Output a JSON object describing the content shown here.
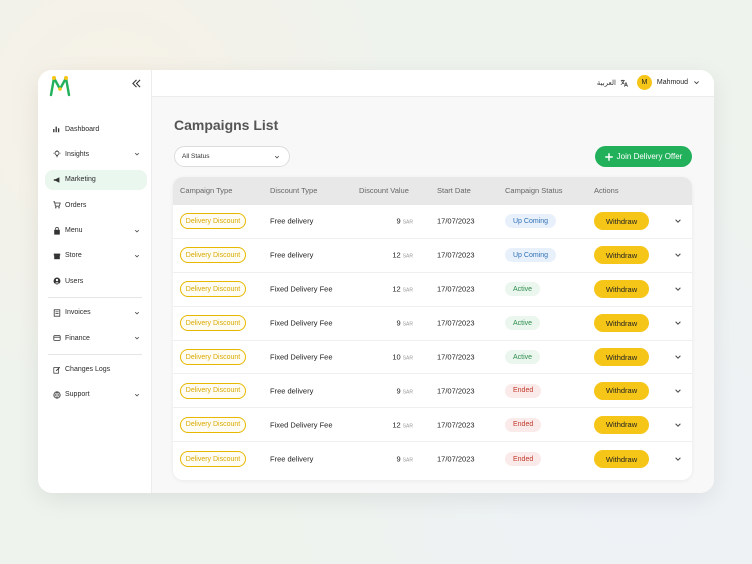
{
  "sidebar": {
    "collapse_icon": "double-chevron-left-icon",
    "items": [
      {
        "label": "Dashboard",
        "icon": "bar-chart-icon",
        "expandable": false
      },
      {
        "label": "Insights",
        "icon": "lightbulb-icon",
        "expandable": true
      },
      {
        "label": "Marketing",
        "icon": "megaphone-icon",
        "expandable": false,
        "active": true
      },
      {
        "label": "Orders",
        "icon": "cart-icon",
        "expandable": false
      },
      {
        "label": "Menu",
        "icon": "bag-icon",
        "expandable": true
      },
      {
        "label": "Store",
        "icon": "store-icon",
        "expandable": true
      },
      {
        "label": "Users",
        "icon": "user-icon",
        "expandable": false
      },
      {
        "label": "Invoices",
        "icon": "invoice-icon",
        "expandable": true
      },
      {
        "label": "Finance",
        "icon": "finance-icon",
        "expandable": true
      },
      {
        "label": "Changes Logs",
        "icon": "edit-icon",
        "expandable": false
      },
      {
        "label": "Support",
        "icon": "globe-icon",
        "expandable": true
      }
    ]
  },
  "topbar": {
    "language": "العربية",
    "user_initial": "M",
    "user_name": "Mahmoud"
  },
  "page": {
    "title": "Campaigns List",
    "filter_value": "All Status",
    "join_button": "Join Delivery Offer"
  },
  "table": {
    "headers": [
      "Campaign Type",
      "Discount Type",
      "Discount Value",
      "Start Date",
      "Campaign Status",
      "Actions"
    ],
    "currency": "SAR",
    "action_label": "Withdraw",
    "rows": [
      {
        "campaign_type": "Delivery Discount",
        "discount_type": "Free delivery",
        "value": "9",
        "date": "17/07/2023",
        "status": "Up Coming",
        "status_kind": "upcoming"
      },
      {
        "campaign_type": "Delivery Discount",
        "discount_type": "Free delivery",
        "value": "12",
        "date": "17/07/2023",
        "status": "Up Coming",
        "status_kind": "upcoming"
      },
      {
        "campaign_type": "Delivery Discount",
        "discount_type": "Fixed Delivery Fee",
        "value": "12",
        "date": "17/07/2023",
        "status": "Active",
        "status_kind": "active"
      },
      {
        "campaign_type": "Delivery Discount",
        "discount_type": "Fixed Delivery Fee",
        "value": "9",
        "date": "17/07/2023",
        "status": "Active",
        "status_kind": "active"
      },
      {
        "campaign_type": "Delivery Discount",
        "discount_type": "Fixed Delivery Fee",
        "value": "10",
        "date": "17/07/2023",
        "status": "Active",
        "status_kind": "active"
      },
      {
        "campaign_type": "Delivery Discount",
        "discount_type": "Free delivery",
        "value": "9",
        "date": "17/07/2023",
        "status": "Ended",
        "status_kind": "ended"
      },
      {
        "campaign_type": "Delivery Discount",
        "discount_type": "Fixed Delivery Fee",
        "value": "12",
        "date": "17/07/2023",
        "status": "Ended",
        "status_kind": "ended"
      },
      {
        "campaign_type": "Delivery Discount",
        "discount_type": "Free delivery",
        "value": "9",
        "date": "17/07/2023",
        "status": "Ended",
        "status_kind": "ended"
      }
    ]
  },
  "colors": {
    "brand_green": "#22b05b",
    "accent_yellow": "#f5c518"
  }
}
